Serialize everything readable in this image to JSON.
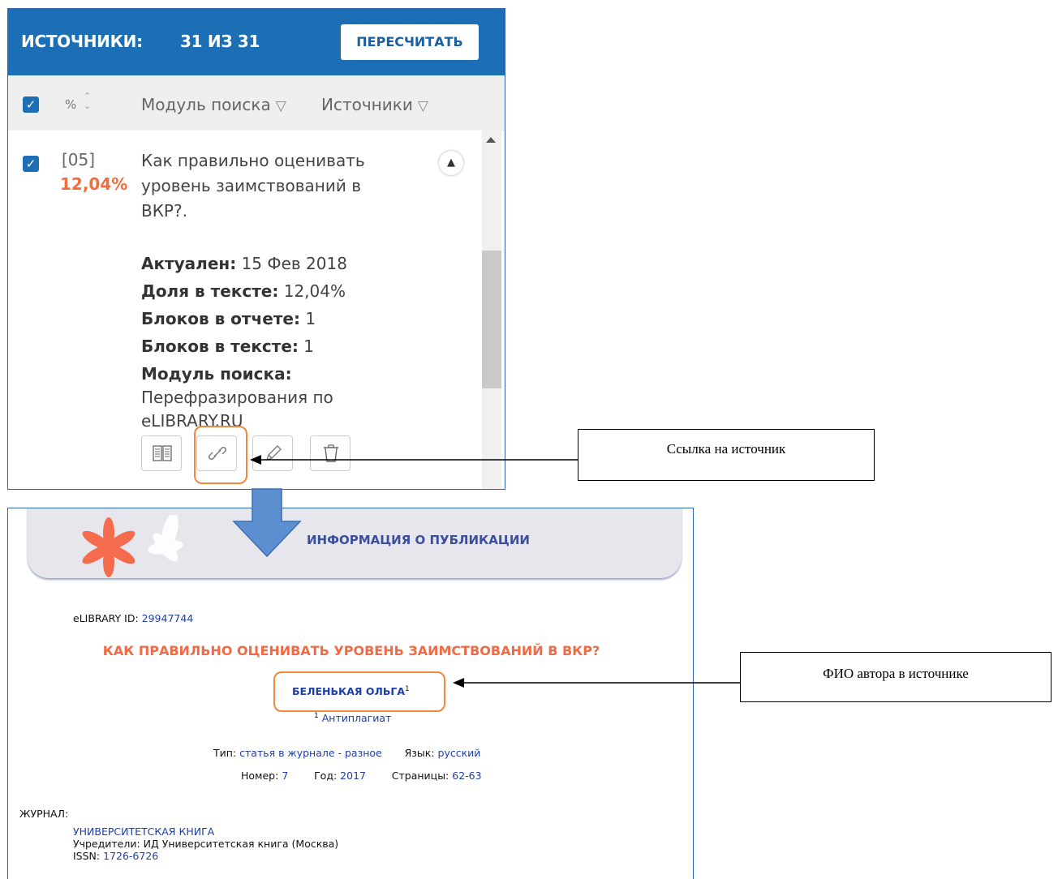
{
  "top_panel": {
    "header": {
      "title": "ИСТОЧНИКИ:",
      "count": "31 ИЗ 31",
      "recalc_button": "ПЕРЕСЧИТАТЬ"
    },
    "filter_row": {
      "percent_label": "%",
      "module_filter": "Модуль поиска",
      "sources_filter": "Источники"
    },
    "source_item": {
      "index": "[05]",
      "percent": "12,04%",
      "title": "Как правильно оценивать уровень заимствований в ВКР?.",
      "actual_label": "Актуален:",
      "actual_value": "15 Фев 2018",
      "share_label": "Доля в тексте:",
      "share_value": "12,04%",
      "blocks_report_label": "Блоков в отчете:",
      "blocks_report_value": "1",
      "blocks_text_label": "Блоков в тексте:",
      "blocks_text_value": "1",
      "module_label": "Модуль поиска:",
      "module_value": "Перефразирования по eLIBRARY.RU"
    }
  },
  "callouts": {
    "link": "Ссылка на источник",
    "author": "ФИО автора в источнике"
  },
  "bottom_panel": {
    "banner_title": "ИНФОРМАЦИЯ О ПУБЛИКАЦИИ",
    "elibrary_id_label": "eLIBRARY ID:",
    "elibrary_id_value": "29947744",
    "pub_title": "КАК ПРАВИЛЬНО ОЦЕНИВАТЬ УРОВЕНЬ ЗАИМСТВОВАНИЙ В ВКР?",
    "author": "БЕЛЕНЬКАЯ ОЛЬГА",
    "author_sup": "1",
    "affiliation_sup": "1",
    "affiliation": "Антиплагиат",
    "type_label": "Тип:",
    "type_value": "статья в журнале - разное",
    "lang_label": "Язык:",
    "lang_value": "русский",
    "number_label": "Номер:",
    "number_value": "7",
    "year_label": "Год:",
    "year_value": "2017",
    "pages_label": "Страницы:",
    "pages_value": "62-63",
    "journal_label": "ЖУРНАЛ:",
    "journal_name": "УНИВЕРСИТЕТСКАЯ КНИГА",
    "journal_founders": "Учредители: ИД Университетская книга (Москва)",
    "journal_issn_label": "ISSN:",
    "journal_issn_value": "1726-6726"
  },
  "colors": {
    "header_blue": "#1c6fb5",
    "percent_orange": "#f26d3d",
    "highlight_orange": "#f0883e",
    "title_red": "#f06a45",
    "link_blue": "#1f3fa8"
  }
}
